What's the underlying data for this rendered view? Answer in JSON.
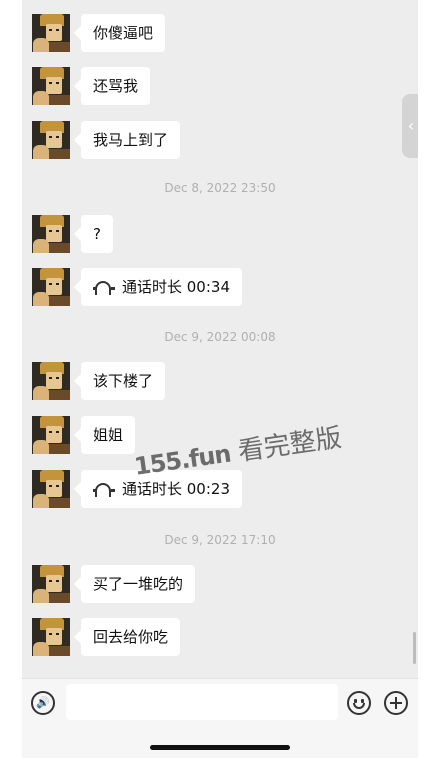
{
  "chat": {
    "messages": [
      {
        "type": "text",
        "text": "你傻逼吧"
      },
      {
        "type": "text",
        "text": "还骂我"
      },
      {
        "type": "text",
        "text": "我马上到了"
      },
      {
        "type": "timestamp",
        "text": "Dec 8, 2022 23:50"
      },
      {
        "type": "text",
        "text": "?"
      },
      {
        "type": "call",
        "text": "通话时长 00:34",
        "icon": "phone-hangup-icon"
      },
      {
        "type": "timestamp",
        "text": "Dec 9, 2022 00:08"
      },
      {
        "type": "text",
        "text": "该下楼了"
      },
      {
        "type": "text",
        "text": "姐姐"
      },
      {
        "type": "call",
        "text": "通话时长 00:23",
        "icon": "phone-hangup-icon"
      },
      {
        "type": "timestamp",
        "text": "Dec 9, 2022 17:10"
      },
      {
        "type": "text",
        "text": "买了一堆吃的"
      },
      {
        "type": "text",
        "text": "回去给你吃"
      }
    ]
  },
  "side_tab": {
    "glyph": "‹",
    "icon": "chevron-left-icon"
  },
  "input_bar": {
    "voice_glyph": "🔊",
    "voice_icon": "voice-icon",
    "emoji_icon": "emoji-icon",
    "plus_icon": "plus-icon"
  },
  "watermark": {
    "domain": "155.fun",
    "caption": "看完整版"
  },
  "colors": {
    "chat_background": "#ededed",
    "bubble": "#ffffff",
    "timestamp_text": "#b0b0b0",
    "input_bar": "#f6f6f6"
  }
}
